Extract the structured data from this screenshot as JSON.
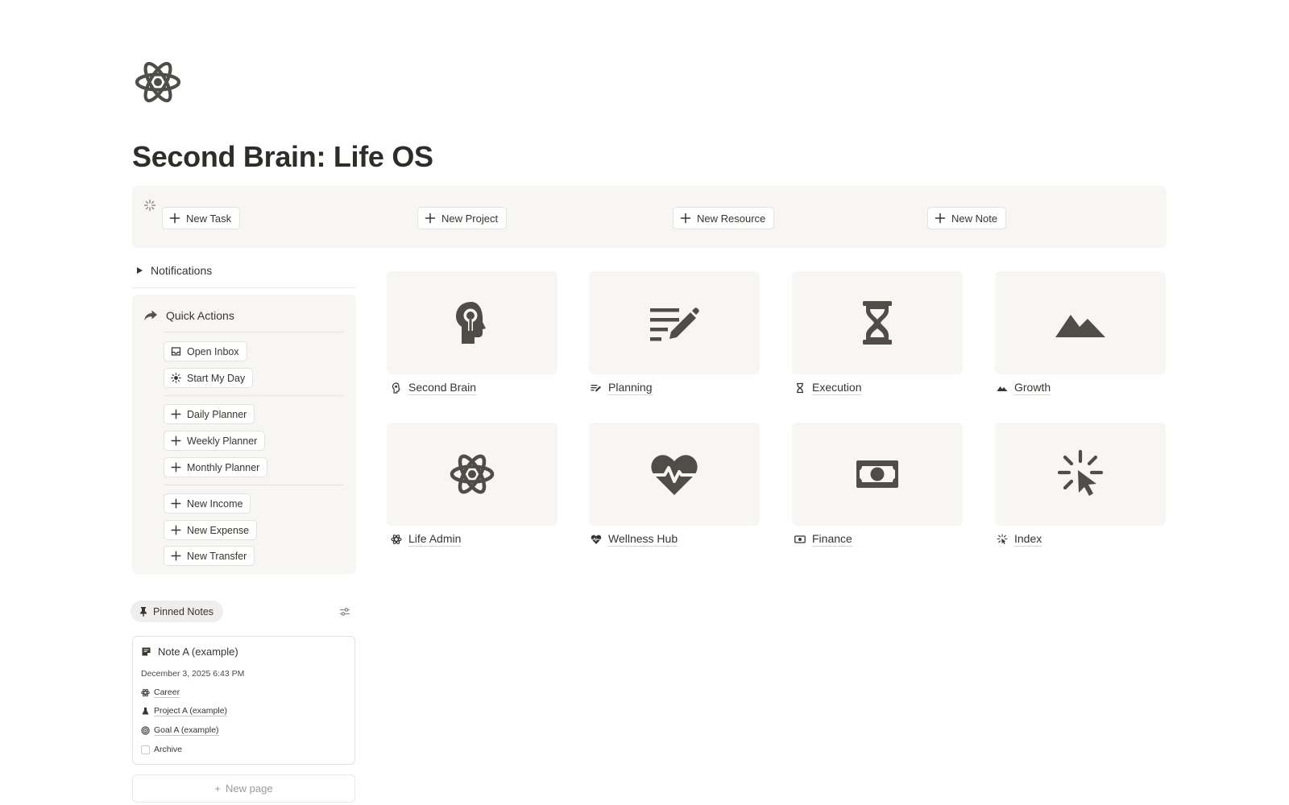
{
  "page": {
    "title": "Second Brain: Life OS",
    "icon": "atom-icon"
  },
  "actions_bar": {
    "icon": "sparkle-icon",
    "buttons": [
      {
        "label": "New Task",
        "icon": "plus-icon"
      },
      {
        "label": "New Project",
        "icon": "plus-icon"
      },
      {
        "label": "New Resource",
        "icon": "plus-icon"
      },
      {
        "label": "New Note",
        "icon": "plus-icon"
      }
    ]
  },
  "notifications": {
    "label": "Notifications",
    "icon": "triangle-right-icon",
    "expanded": false
  },
  "quick_actions": {
    "title": "Quick Actions",
    "icon": "share-arrow-icon",
    "groups": [
      [
        {
          "label": "Open Inbox",
          "icon": "inbox-icon"
        },
        {
          "label": "Start My Day",
          "icon": "sun-icon"
        }
      ],
      [
        {
          "label": "Daily Planner",
          "icon": "plus-icon"
        },
        {
          "label": "Weekly Planner",
          "icon": "plus-icon"
        },
        {
          "label": "Monthly Planner",
          "icon": "plus-icon"
        }
      ],
      [
        {
          "label": "New Income",
          "icon": "plus-icon"
        },
        {
          "label": "New Expense",
          "icon": "plus-icon"
        },
        {
          "label": "New Transfer",
          "icon": "plus-icon"
        }
      ]
    ]
  },
  "pinned": {
    "label": "Pinned Notes",
    "icon": "pin-icon",
    "filter_icon": "sliders-icon",
    "note": {
      "title": "Note A (example)",
      "icon": "note-icon",
      "date": "December 3, 2025 6:43 PM",
      "area": "Career",
      "project": "Project A (example)",
      "goal": "Goal A (example)",
      "archive_label": "Archive",
      "archived": false
    },
    "new_page_label": "New page"
  },
  "tiles": [
    {
      "label": "Second Brain",
      "icon": "head-bulb-icon"
    },
    {
      "label": "Planning",
      "icon": "list-pencil-icon"
    },
    {
      "label": "Execution",
      "icon": "hourglass-icon"
    },
    {
      "label": "Growth",
      "icon": "mountain-icon"
    },
    {
      "label": "Life Admin",
      "icon": "atom-icon"
    },
    {
      "label": "Wellness Hub",
      "icon": "heart-pulse-icon"
    },
    {
      "label": "Finance",
      "icon": "cash-icon"
    },
    {
      "label": "Index",
      "icon": "cursor-click-icon"
    }
  ],
  "colors": {
    "text": "#37352f",
    "icon": "#4f4d48",
    "panel_bg": "#f7f6f3",
    "border": "#e3e2de"
  }
}
